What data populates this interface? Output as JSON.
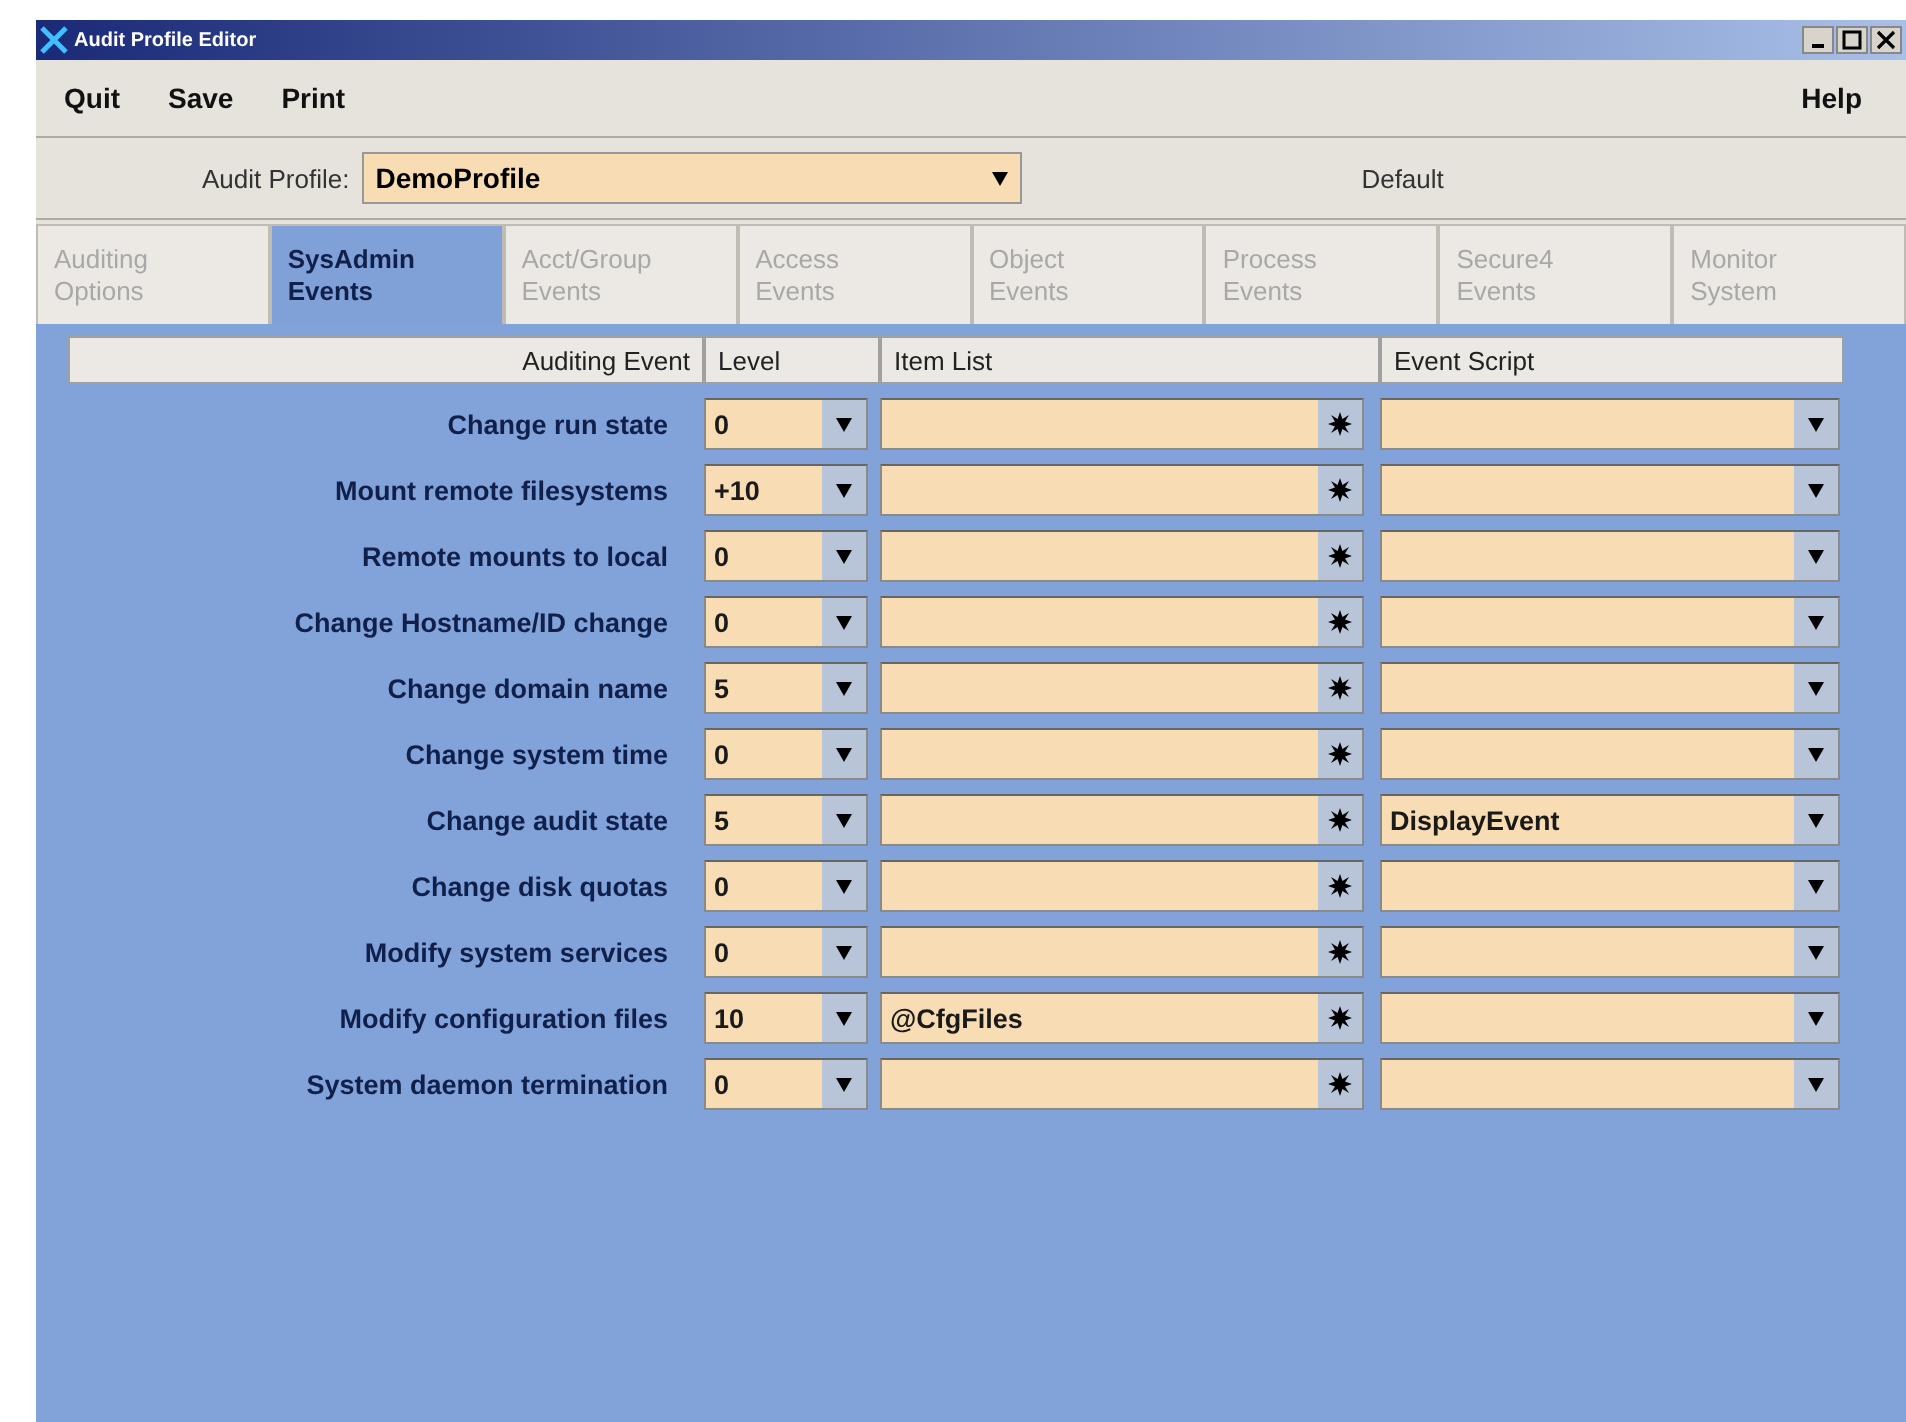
{
  "window": {
    "title": "Audit Profile Editor"
  },
  "menu": {
    "left": [
      "Quit",
      "Save",
      "Print"
    ],
    "right": "Help"
  },
  "profile": {
    "label": "Audit Profile:",
    "value": "DemoProfile",
    "default_label": "Default"
  },
  "tabs": [
    {
      "lines": [
        "Auditing",
        "Options"
      ],
      "selected": false
    },
    {
      "lines": [
        "SysAdmin",
        "Events"
      ],
      "selected": true
    },
    {
      "lines": [
        "Acct/Group",
        "Events"
      ],
      "selected": false
    },
    {
      "lines": [
        "Access",
        "Events"
      ],
      "selected": false
    },
    {
      "lines": [
        "Object",
        "Events"
      ],
      "selected": false
    },
    {
      "lines": [
        "Process",
        "Events"
      ],
      "selected": false
    },
    {
      "lines": [
        "Secure4",
        "Events"
      ],
      "selected": false
    },
    {
      "lines": [
        "Monitor",
        "System"
      ],
      "selected": false
    }
  ],
  "table": {
    "columns": [
      "Auditing Event",
      "Level",
      "Item List",
      "Event Script"
    ],
    "rows": [
      {
        "event": "Change run state",
        "level": "0",
        "items": "",
        "script": ""
      },
      {
        "event": "Mount remote filesystems",
        "level": "+10",
        "items": "",
        "script": ""
      },
      {
        "event": "Remote mounts to local",
        "level": "0",
        "items": "",
        "script": ""
      },
      {
        "event": "Change Hostname/ID change",
        "level": "0",
        "items": "",
        "script": ""
      },
      {
        "event": "Change domain name",
        "level": "5",
        "items": "",
        "script": ""
      },
      {
        "event": "Change system time",
        "level": "0",
        "items": "",
        "script": ""
      },
      {
        "event": "Change audit state",
        "level": "5",
        "items": "",
        "script": "DisplayEvent"
      },
      {
        "event": "Change disk quotas",
        "level": "0",
        "items": "",
        "script": ""
      },
      {
        "event": "Modify system services",
        "level": "0",
        "items": "",
        "script": ""
      },
      {
        "event": "Modify configuration files",
        "level": "10",
        "items": "@CfgFiles",
        "script": ""
      },
      {
        "event": "System daemon termination",
        "level": "0",
        "items": "",
        "script": ""
      }
    ]
  }
}
